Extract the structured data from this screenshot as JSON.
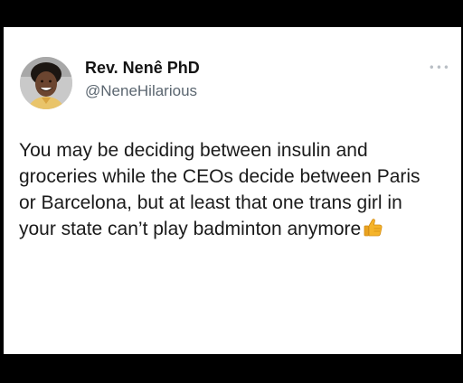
{
  "tweet": {
    "author_name": "Rev. Nenê PhD",
    "author_handle": "@NeneHilarious",
    "more_icon": "more-options-icon",
    "text_lines": [
      "You may be deciding between insulin and",
      "groceries while the CEOs decide between Paris",
      "or Barcelona, but at least that one trans girl in",
      "your state can’t play badminton anymore"
    ],
    "emoji": "thumbs-up-icon"
  },
  "colors": {
    "card_background": "#ffffff",
    "frame_background": "#000000",
    "text": "#1a1a1a",
    "handle": "#5b6670",
    "emoji": "#f5b42a"
  }
}
